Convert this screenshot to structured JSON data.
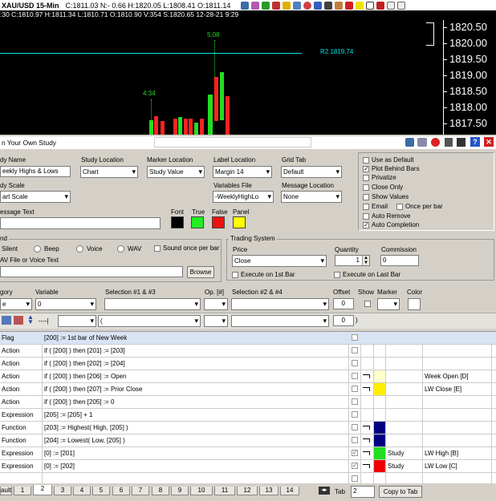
{
  "chart": {
    "title": "XAU/USD  15-Min",
    "ohlc": "C:1811.03  N:- 0.66  H:1820.05  L:1808.41  O:1811.14",
    "info": ":30  C:1810.97  H:1811.34  L:1810.71  O:1810.90  V:354  S:1820.65  12-28-21  9:29",
    "price_labels": [
      "1820.50",
      "1820.00",
      "1819.50",
      "1819.00",
      "1818.50",
      "1818.00",
      "1817.50"
    ],
    "annotation_top": "5:08",
    "annotation_mid": "4:34",
    "r2_label": "R2  1819.74",
    "colors": {
      "up": "#22dd22",
      "down": "#ff2222",
      "line": "#00e5e5"
    }
  },
  "panel": {
    "title": "n Your Own Study",
    "study_name": {
      "label": "dy Name",
      "value": "eekly Highs & Lows"
    },
    "study_location": {
      "label": "Study Location",
      "value": "Chart"
    },
    "marker_location": {
      "label": "Marker Location",
      "value": "Study Value"
    },
    "label_location": {
      "label": "Label Location",
      "value": "Margin 14"
    },
    "grid_tab": {
      "label": "Grid Tab",
      "value": "Default"
    },
    "study_scale": {
      "label": "dy Scale",
      "value": "art Scale"
    },
    "variables_file": {
      "label": "Variables File",
      "value": "-WeeklyHighLo"
    },
    "message_location": {
      "label": "Message Location",
      "value": "None"
    },
    "message_text": {
      "label": "essage Text"
    },
    "colors_labels": {
      "font": "Font",
      "true": "True",
      "false": "False",
      "panel": "Panel"
    },
    "options": {
      "use_as_default": "Use as Default",
      "plot_behind_bars": "Plot Behind Bars",
      "privatize": "Privatize",
      "close_only": "Close Only",
      "show_values": "Show Values",
      "email": "Email",
      "once_per_bar": "Once per bar",
      "auto_remove": "Auto Remove",
      "auto_completion": "Auto Completion"
    },
    "sound": {
      "label": "nd",
      "silent": "Silent",
      "beep": "Beep",
      "voice": "Voice",
      "wav": "WAV",
      "once_per_bar": "Sound once per bar",
      "file_label": "AV File  or  Voice Text",
      "browse": "Browse"
    },
    "trading": {
      "label": "Trading System",
      "price_label": "Price",
      "price_value": "Close",
      "quantity_label": "Quantity",
      "quantity_value": "1",
      "commission_label": "Commission",
      "commission_value": "0",
      "exec_first": "Execute on 1st Bar",
      "exec_last": "Execute on Last Bar"
    },
    "grid_headers": {
      "category": "gory",
      "variable": "Variable",
      "sel13": "Selection #1 & #3",
      "op": "Op. [#]",
      "sel24": "Selection #2 & #4",
      "offset": "Offset",
      "show": "Show",
      "marker": "Marker",
      "color": "Color"
    },
    "editor": {
      "category_value": "e",
      "variable_value": "0",
      "offset1": "0",
      "offset2": "0",
      "paren_open": "(",
      "paren_close": ")",
      "dash": "----|"
    },
    "rows": [
      {
        "category": "Flag",
        "expr": "[200] :=  1st bar of New Week",
        "checked": false,
        "color": "",
        "marker": "",
        "label": ""
      },
      {
        "category": "Action",
        "expr": "if ( [200] ) then [201] := [203]",
        "checked": false,
        "color": "",
        "marker": "",
        "label": ""
      },
      {
        "category": "Action",
        "expr": "if ( [200] ) then [202] := [204]",
        "checked": false,
        "color": "",
        "marker": "",
        "label": ""
      },
      {
        "category": "Action",
        "expr": "if ( [200] ) then [206] := Open",
        "checked": false,
        "color": "#ffffcc",
        "marker": "",
        "label": "Week Open [D]"
      },
      {
        "category": "Action",
        "expr": "if ( [200] ) then [207] := Prior Close",
        "checked": false,
        "color": "#ffee00",
        "marker": "",
        "label": "LW Close [E]"
      },
      {
        "category": "Action",
        "expr": "if ( [200] ) then [205] := 0",
        "checked": false,
        "color": "",
        "marker": "",
        "label": ""
      },
      {
        "category": "Expression",
        "expr": "[205] := [205] + 1",
        "checked": false,
        "color": "",
        "marker": "",
        "label": ""
      },
      {
        "category": "Function",
        "expr": "[203] := Highest( High, [205] )",
        "checked": false,
        "color": "#000080",
        "marker": "",
        "label": ""
      },
      {
        "category": "Function",
        "expr": "[204] := Lowest( Low, [205] )",
        "checked": false,
        "color": "#000080",
        "marker": "",
        "label": ""
      },
      {
        "category": "Expression",
        "expr": "[0] := [201]",
        "checked": true,
        "color": "#22dd22",
        "marker": "Study",
        "label": "LW High [B]"
      },
      {
        "category": "Expression",
        "expr": "[0] := [202]",
        "checked": true,
        "color": "#ee0000",
        "marker": "Study",
        "label": "LW Low [C]"
      }
    ],
    "tabs": [
      "ault",
      "1",
      "2",
      "3",
      "4",
      "5",
      "6",
      "7",
      "8",
      "9",
      "10",
      "11",
      "12",
      "13",
      "14"
    ],
    "tab_label": "Tab",
    "tab_value": "2",
    "copy_to_tab": "Copy to Tab"
  }
}
